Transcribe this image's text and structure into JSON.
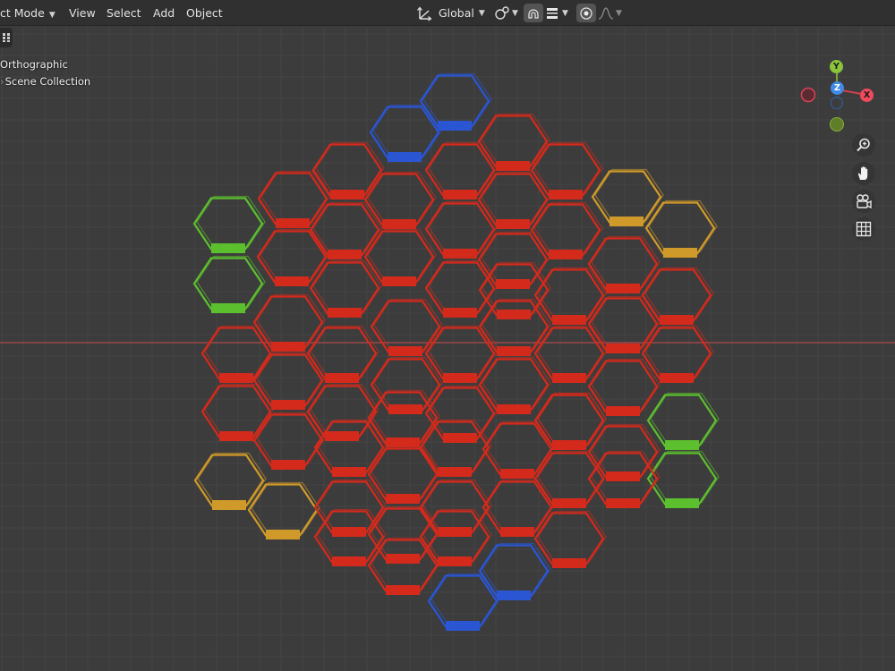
{
  "header": {
    "mode_label": "ct Mode",
    "menus": [
      "View",
      "Select",
      "Add",
      "Object"
    ],
    "transform_orientation": "Global"
  },
  "viewport": {
    "view_name": "Orthographic",
    "collection": "Scene Collection",
    "gizmo_labels": {
      "y": "Y",
      "z": "Z",
      "x": "X"
    }
  },
  "colors": {
    "background": "#3c3c3c",
    "header": "#303030",
    "red_axis_line": "#b0484c",
    "hex_red": "#d42a1c",
    "hex_blue": "#2a56d4",
    "hex_green": "#5cc02e",
    "hex_yellow": "#d09a2a",
    "gizmo_x": "#f04a5c",
    "gizmo_y": "#8bc43a",
    "gizmo_z": "#3f8ae6"
  },
  "icons": [
    "menu-caret-icon",
    "transform-axes-icon",
    "snap-icon",
    "snap-increment-icon",
    "proportional-edit-icon",
    "falloff-curve-icon",
    "zoom-icon",
    "hand-icon",
    "camera-icon",
    "grid-icon"
  ]
}
